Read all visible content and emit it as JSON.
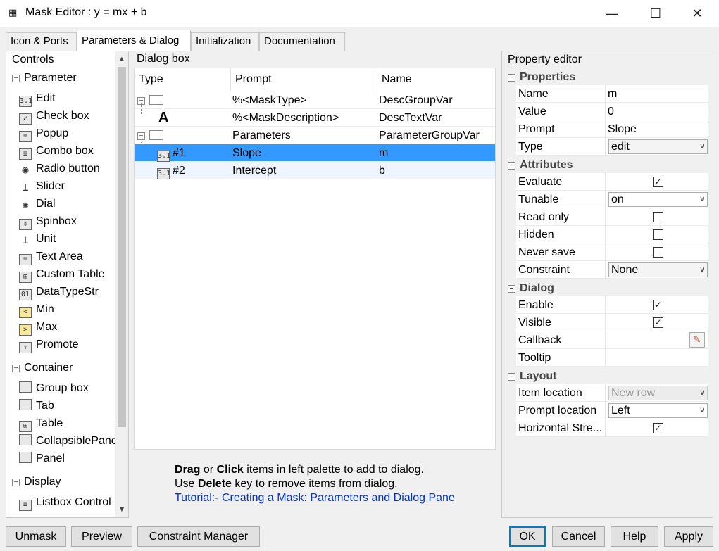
{
  "window": {
    "title": "Mask Editor : y = mx + b"
  },
  "tabs": [
    "Icon & Ports",
    "Parameters & Dialog",
    "Initialization",
    "Documentation"
  ],
  "controls": {
    "header": "Controls",
    "sections": [
      {
        "label": "Parameter",
        "items": [
          "Edit",
          "Check box",
          "Popup",
          "Combo box",
          "Radio button",
          "Slider",
          "Dial",
          "Spinbox",
          "Unit",
          "Text Area",
          "Custom Table",
          "DataTypeStr",
          "Min",
          "Max",
          "Promote"
        ]
      },
      {
        "label": "Container",
        "items": [
          "Group box",
          "Tab",
          "Table",
          "CollapsiblePanel",
          "Panel"
        ]
      },
      {
        "label": "Display",
        "items": [
          "Listbox Control"
        ]
      }
    ]
  },
  "dialog_box": {
    "header": "Dialog box",
    "columns": [
      "Type",
      "Prompt",
      "Name"
    ],
    "rows": [
      {
        "type": "",
        "prompt": "%<MaskType>",
        "name": "DescGroupVar"
      },
      {
        "type": "",
        "prompt": "%<MaskDescription>",
        "name": "DescTextVar"
      },
      {
        "type": "",
        "prompt": "Parameters",
        "name": "ParameterGroupVar"
      },
      {
        "type": "#1",
        "prompt": "Slope",
        "name": "m"
      },
      {
        "type": "#2",
        "prompt": "Intercept",
        "name": "b"
      }
    ],
    "help": {
      "drag": "Drag",
      "or": " or ",
      "click": "Click",
      "line1_rest": " items in left palette to add to dialog.",
      "use": "Use ",
      "delete": "Delete",
      "line2_rest": " key to remove items from dialog.",
      "tutorial_link": "Tutorial:- Creating a Mask: Parameters and Dialog Pane"
    }
  },
  "property_editor": {
    "header": "Property editor",
    "groups": {
      "properties": "Properties",
      "attributes": "Attributes",
      "dialog": "Dialog",
      "layout": "Layout"
    },
    "name": {
      "label": "Name",
      "value": "m"
    },
    "value": {
      "label": "Value",
      "value": "0"
    },
    "prompt": {
      "label": "Prompt",
      "value": "Slope"
    },
    "type": {
      "label": "Type",
      "value": "edit"
    },
    "evaluate": {
      "label": "Evaluate",
      "checked": "✓"
    },
    "tunable": {
      "label": "Tunable",
      "value": "on"
    },
    "read_only": {
      "label": "Read only",
      "checked": ""
    },
    "hidden": {
      "label": "Hidden",
      "checked": ""
    },
    "never_save": {
      "label": "Never save",
      "checked": ""
    },
    "constraint": {
      "label": "Constraint",
      "value": "None"
    },
    "enable": {
      "label": "Enable",
      "checked": "✓"
    },
    "visible": {
      "label": "Visible",
      "checked": "✓"
    },
    "callback": {
      "label": "Callback"
    },
    "tooltip": {
      "label": "Tooltip"
    },
    "item_location": {
      "label": "Item location",
      "value": "New row"
    },
    "prompt_location": {
      "label": "Prompt location",
      "value": "Left"
    },
    "horizontal_stretch": {
      "label": "Horizontal Stre...",
      "checked": "✓"
    }
  },
  "buttons": {
    "unmask": "Unmask",
    "preview": "Preview",
    "constraint_manager": "Constraint Manager",
    "ok": "OK",
    "cancel": "Cancel",
    "help": "Help",
    "apply": "Apply"
  }
}
